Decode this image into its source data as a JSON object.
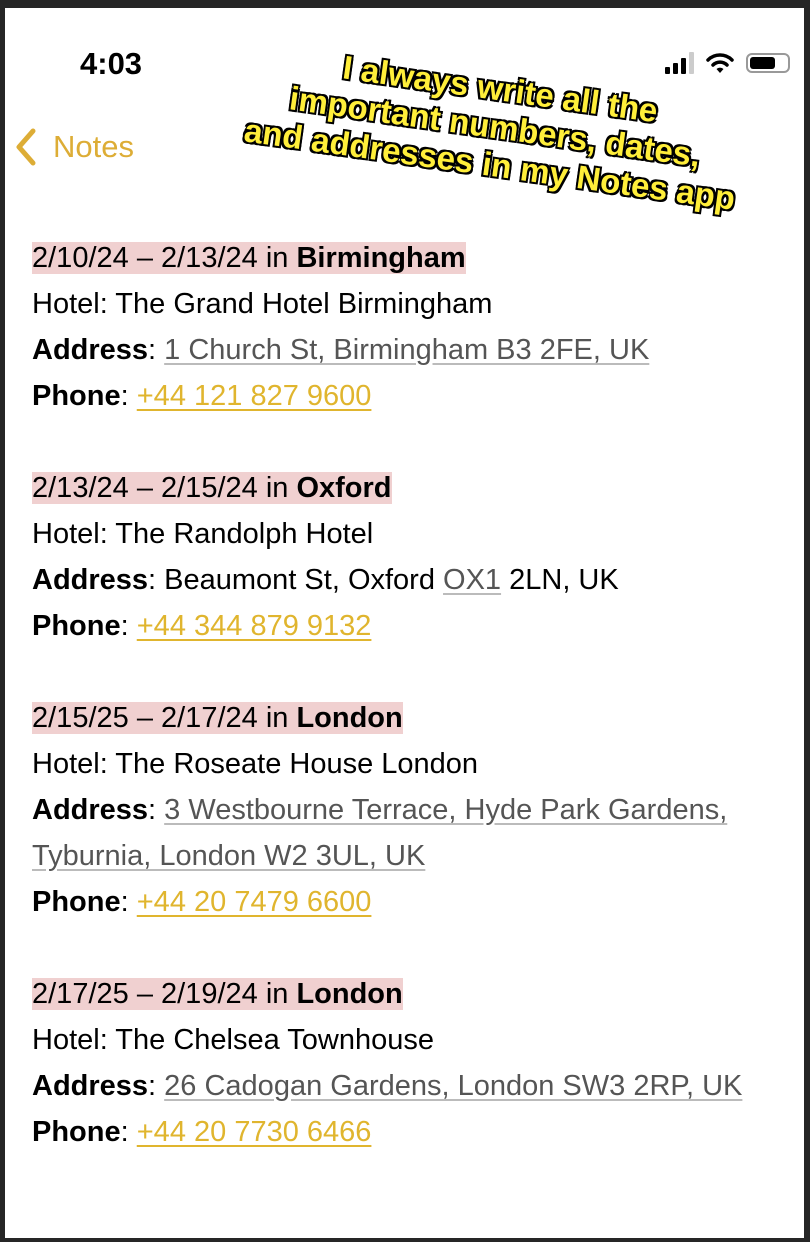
{
  "status_bar": {
    "time": "4:03"
  },
  "nav": {
    "back_label": "Notes"
  },
  "caption": [
    "I always write all the",
    "important numbers, dates,",
    "and addresses in my Notes app"
  ],
  "labels": {
    "hotel": "Hotel: ",
    "address": "Address",
    "phone": "Phone",
    "colon": ": ",
    "in": " in "
  },
  "entries": [
    {
      "dates": "2/10/24 – 2/13/24",
      "city": "Birmingham",
      "hotel": "The Grand Hotel Birmingham",
      "address_link": "1 Church St, Birmingham B3 2FE, UK",
      "phone": "+44 121 827 9600"
    },
    {
      "dates": "2/13/24 – 2/15/24",
      "city": "Oxford",
      "hotel": "The Randolph Hotel",
      "address_pre": "Beaumont St, Oxford ",
      "address_link": "OX1",
      "address_post": " 2LN, UK",
      "phone": "+44 344 879 9132"
    },
    {
      "dates": "2/15/25 – 2/17/24",
      "city": "London",
      "hotel": "The Roseate House London",
      "address_link": "3 Westbourne Terrace, Hyde Park Gardens, Tyburnia, London W2 3UL, UK",
      "phone": "+44 20 7479 6600"
    },
    {
      "dates": "2/17/25 – 2/19/24",
      "city": "London",
      "hotel": "The Chelsea Townhouse",
      "address_link": "26 Cadogan Gardens, London SW3 2RP, UK",
      "phone": "+44 20 7730 6466"
    }
  ],
  "colors": {
    "accent": "#ddad36",
    "highlight": "#f0d0d0",
    "link": "#e0b52e"
  }
}
